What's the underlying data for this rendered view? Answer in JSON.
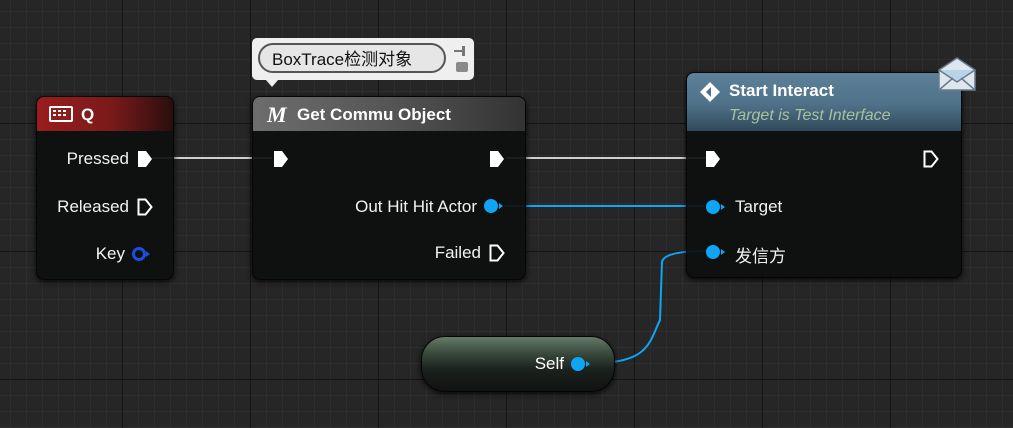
{
  "nodes": {
    "q_event": {
      "title": "Q",
      "icon": "keyboard-icon",
      "header_color": "#9a1d1d",
      "pins": {
        "pressed": "Pressed",
        "released": "Released",
        "key": "Key"
      }
    },
    "get_commu": {
      "title": "Get Commu Object",
      "title_prefix": "M",
      "comment": "BoxTrace检测对象",
      "pins": {
        "out_hit_actor": "Out Hit Hit Actor",
        "failed": "Failed"
      }
    },
    "start_interact": {
      "title": "Start Interact",
      "subtitle": "Target is Test Interface",
      "icon": "interface-diamond-icon",
      "badge_icon": "message-envelope-icon",
      "pins": {
        "target": "Target",
        "sender": "发信方"
      }
    },
    "self_node": {
      "label": "Self"
    }
  },
  "colors": {
    "object_pin": "#0ea5f5",
    "exec_wire": "#d8d8d8",
    "interface_header": "#5a7f99"
  }
}
